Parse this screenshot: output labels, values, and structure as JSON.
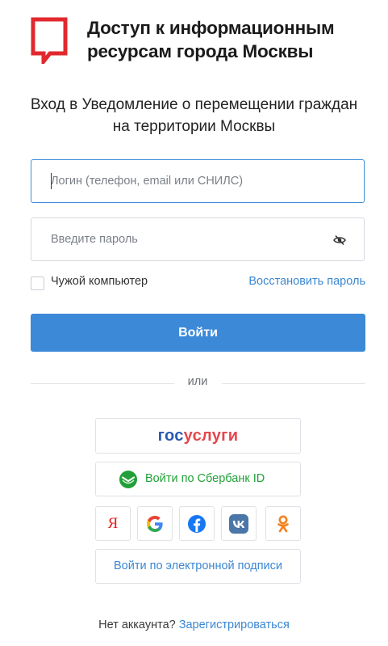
{
  "header": {
    "title": "Доступ к информационным ресурсам города Москвы",
    "logo_color": "#e1282d"
  },
  "subtitle": "Вход в Уведомление о перемещении граждан на территории Москвы",
  "form": {
    "login_placeholder": "Логин (телефон, email или СНИЛС)",
    "login_value": "",
    "password_placeholder": "Введите пароль",
    "password_value": "",
    "checkbox_label": "Чужой компьютер",
    "checkbox_checked": false,
    "restore_link": "Восстановить пароль",
    "login_button": "Войти"
  },
  "divider": "или",
  "providers": {
    "gosuslugi_part1": "гос",
    "gosuslugi_part2": "услуги",
    "sber_label": "Войти по Сбербанк ID",
    "social_icons": [
      "yandex-icon",
      "google-icon",
      "facebook-icon",
      "vk-icon",
      "odnoklassniki-icon"
    ],
    "yandex_letter": "Я",
    "signature_label": "Войти по электронной подписи"
  },
  "footer": {
    "text": "Нет аккаунта?",
    "register_link": "Зарегистрироваться"
  },
  "colors": {
    "accent": "#3c89d8",
    "link": "#3b87d2",
    "sber_green": "#21a038",
    "gos_blue": "#2b59b0",
    "gos_red": "#e3464b"
  }
}
